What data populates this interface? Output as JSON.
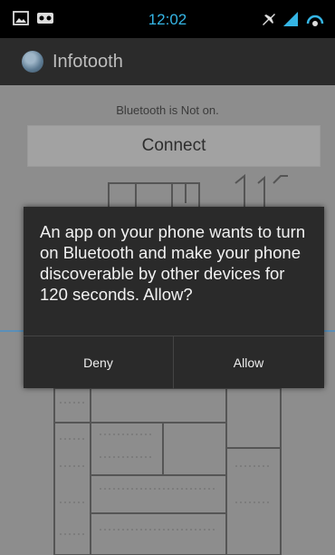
{
  "status_bar": {
    "time": "12:02",
    "icons": [
      "image-notification-icon",
      "voicemail-icon",
      "airplane-mode-icon",
      "signal-icon",
      "battery-icon"
    ]
  },
  "app": {
    "title": "Infotooth"
  },
  "content": {
    "status_text": "Bluetooth is Not on.",
    "connect_label": "Connect"
  },
  "dialog": {
    "message": "An app on your phone wants to turn on Bluetooth and make your phone discoverable by other devices for 120 seconds. Allow?",
    "deny_label": "Deny",
    "allow_label": "Allow"
  },
  "colors": {
    "accent": "#35b5e5",
    "background": "#8d8d8d",
    "dialog": "#2a2a2a",
    "action_bar": "#2b2b2b"
  }
}
